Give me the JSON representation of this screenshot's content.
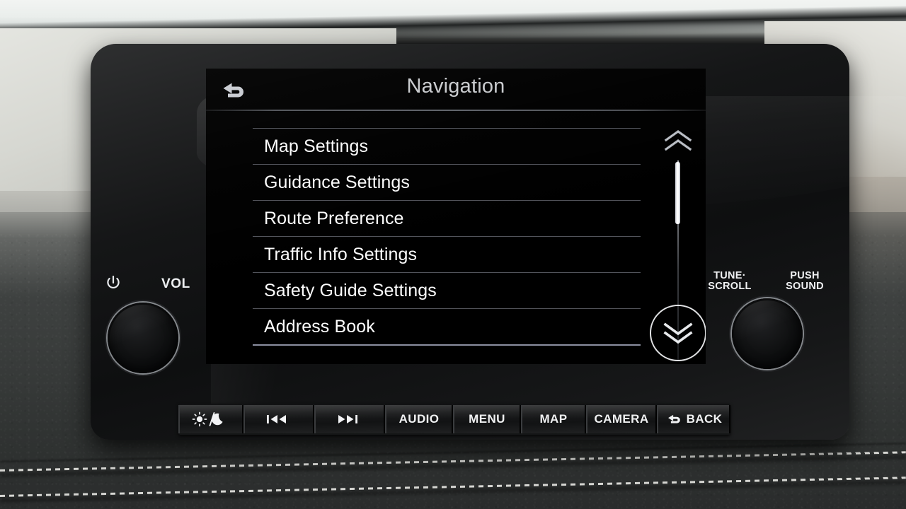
{
  "screen": {
    "title": "Navigation",
    "back_icon": "back-arrow-icon",
    "menu_items": [
      {
        "label": "Map Settings"
      },
      {
        "label": "Guidance Settings"
      },
      {
        "label": "Route Preference"
      },
      {
        "label": "Traffic Info Settings"
      },
      {
        "label": "Safety Guide Settings"
      },
      {
        "label": "Address Book"
      }
    ],
    "scrollbar": {
      "up_icon": "double-chevron-up-icon",
      "down_icon": "double-chevron-down-icon",
      "thumb_position_percent": 1,
      "thumb_size_percent": 31
    },
    "colors": {
      "display_background": "#000000",
      "title_text": "#c9cbce",
      "item_text": "#fdfdfd",
      "separator": "#9ca0ac",
      "accent_separator": "#b2b8cd",
      "scroll_thumb": "#ffffff"
    }
  },
  "controls": {
    "left_knob": {
      "power_icon": "power-icon",
      "label": "VOL",
      "knob_name": "volume-knob"
    },
    "right_knob": {
      "label_tune": "TUNE·\nSCROLL",
      "label_tune_line1": "TUNE·",
      "label_tune_line2": "SCROLL",
      "label_push_line1": "PUSH",
      "label_push_line2": "SOUND",
      "knob_name": "tune-scroll-knob"
    }
  },
  "hard_keys": [
    {
      "name": "day-night",
      "label": "",
      "icon": "sun-moon-icon"
    },
    {
      "name": "previous",
      "label": "",
      "icon": "previous-track-icon"
    },
    {
      "name": "next",
      "label": "",
      "icon": "next-track-icon"
    },
    {
      "name": "audio",
      "label": "AUDIO",
      "icon": ""
    },
    {
      "name": "menu",
      "label": "MENU",
      "icon": ""
    },
    {
      "name": "map",
      "label": "MAP",
      "icon": ""
    },
    {
      "name": "camera",
      "label": "CAMERA",
      "icon": ""
    },
    {
      "name": "back",
      "label": "BACK",
      "icon": "back-arrow-icon"
    }
  ]
}
